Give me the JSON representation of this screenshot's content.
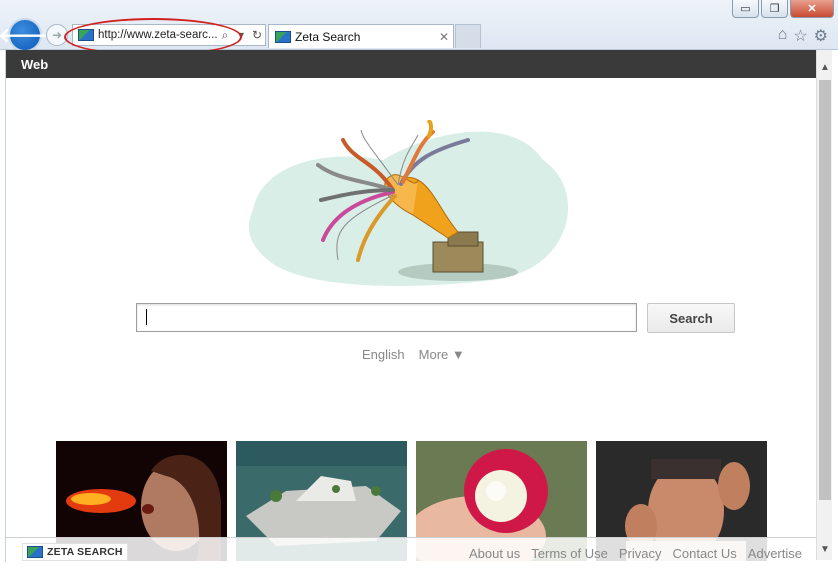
{
  "window": {
    "minimize_glyph": "▭",
    "restore_glyph": "❐",
    "close_glyph": "✕"
  },
  "browser": {
    "back_icon": "back-arrow-icon",
    "back_glyph": "🡐",
    "forward_glyph": "➜",
    "address": {
      "url": "http://www.zeta-searc...",
      "search_glyph": "⌕",
      "dropdown_glyph": "▾",
      "refresh_glyph": "↻"
    },
    "tabs": [
      {
        "title": "Zeta Search",
        "close_glyph": "✕"
      }
    ],
    "tools": {
      "home_glyph": "⌂",
      "favorites_glyph": "☆",
      "settings_glyph": "⚙"
    }
  },
  "page": {
    "nav_label": "Web",
    "search": {
      "value": "",
      "button_label": "Search"
    },
    "links": {
      "language": "English",
      "more": "More ▼"
    },
    "footer": {
      "logo_text": "ZETA SEARCH",
      "links": [
        "About us",
        "Terms of Use",
        "Privacy",
        "Contact Us",
        "Advertise"
      ]
    }
  },
  "colors": {
    "nav_bar": "#3a3a3a",
    "annotation_red": "#d02020",
    "link_gray": "#888888"
  }
}
